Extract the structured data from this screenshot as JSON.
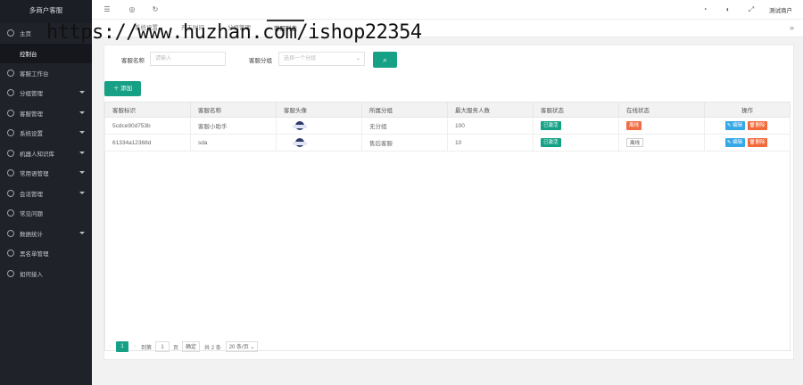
{
  "app": {
    "title": "多商户客服"
  },
  "sidebar": {
    "items": [
      {
        "label": "主页",
        "caret": false
      },
      {
        "label": "控制台",
        "sub": true
      },
      {
        "label": "客服工作台",
        "caret": false
      },
      {
        "label": "分组管理",
        "caret": true
      },
      {
        "label": "客服管理",
        "caret": true
      },
      {
        "label": "系统设置",
        "caret": true
      },
      {
        "label": "机器人知识库",
        "caret": true
      },
      {
        "label": "常用语管理",
        "caret": true
      },
      {
        "label": "会话管理",
        "caret": true
      },
      {
        "label": "常见问题",
        "caret": false
      },
      {
        "label": "数据统计",
        "caret": true
      },
      {
        "label": "黑名单管理",
        "caret": false
      },
      {
        "label": "如何接入",
        "caret": false
      }
    ]
  },
  "topbar": {
    "user": "测试商户"
  },
  "tabs": [
    {
      "label": "系统设置"
    },
    {
      "label": "开工时间"
    },
    {
      "label": "分组管理"
    },
    {
      "label": "客服列表",
      "active": true
    }
  ],
  "filters": {
    "name_label": "客服名称",
    "name_placeholder": "请输入",
    "group_label": "客服分组",
    "group_placeholder": "选择一个分组"
  },
  "add_button": "添加",
  "table": {
    "headers": [
      "客服标识",
      "客服名称",
      "客服头像",
      "所属分组",
      "最大服务人数",
      "客服状态",
      "在线状态",
      "操作"
    ],
    "rows": [
      {
        "id": "5cdce90d753b",
        "name": "客服小助手",
        "group": "无分组",
        "max": "100",
        "status": "已激活",
        "online": "离线"
      },
      {
        "id": "61334a12368d",
        "name": "sda",
        "group": "售后客服",
        "max": "10",
        "status": "已激活",
        "online": "离线"
      }
    ],
    "edit": "编辑",
    "delete": "删除"
  },
  "pager": {
    "current": "1",
    "goto": "到第",
    "page_input": "1",
    "page_unit": "页",
    "confirm": "确定",
    "total": "共 2 条",
    "size": "20 条/页"
  },
  "watermark": "https://www.huzhan.com/ishop22354",
  "colors": {
    "accent": "#16a085",
    "sidebar": "#20222a",
    "edit": "#35a8e8",
    "delete": "#f26a3c"
  }
}
